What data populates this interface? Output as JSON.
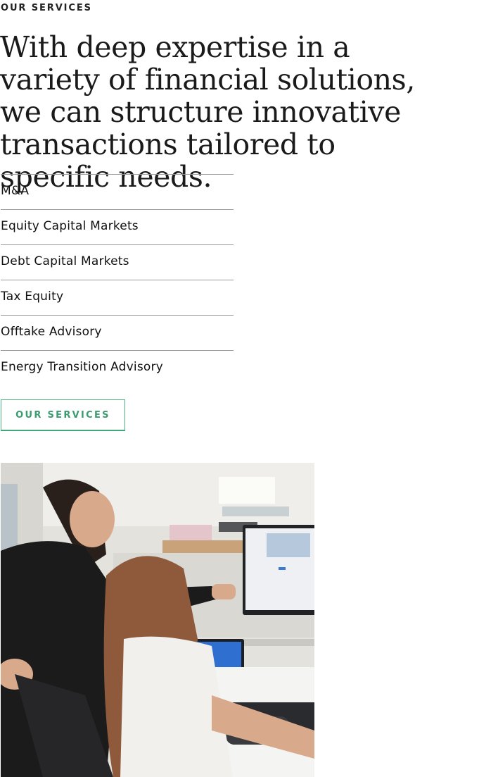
{
  "section": {
    "eyebrow": "OUR SERVICES",
    "headline": "With deep expertise in a variety of financial solutions, we can structure innovative transactions tailored to specific needs."
  },
  "services": [
    {
      "label": "M&A"
    },
    {
      "label": "Equity Capital Markets"
    },
    {
      "label": "Debt Capital Markets"
    },
    {
      "label": "Tax Equity"
    },
    {
      "label": "Offtake Advisory"
    },
    {
      "label": "Energy Transition Advisory"
    }
  ],
  "cta": {
    "label": "OUR SERVICES"
  },
  "colors": {
    "accent": "#3a9c70",
    "divider": "#9a9a9a",
    "text": "#111111"
  }
}
